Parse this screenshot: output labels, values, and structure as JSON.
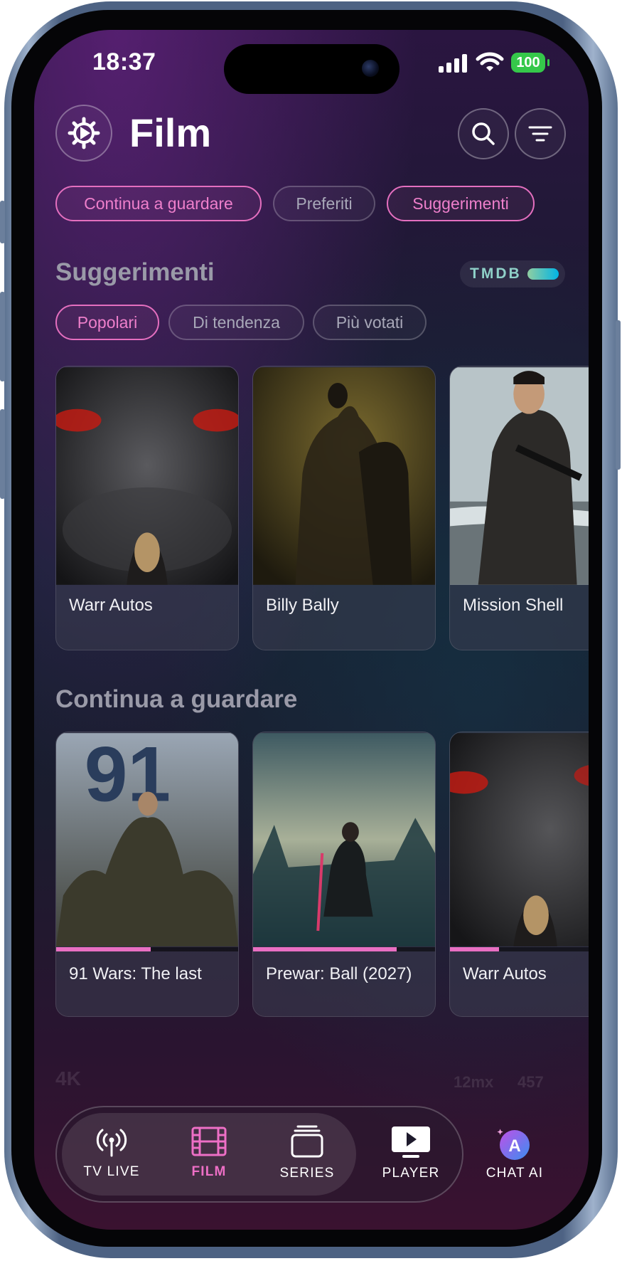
{
  "status_bar": {
    "time": "18:37",
    "battery": "100"
  },
  "header": {
    "title": "Film"
  },
  "top_filters": [
    {
      "label": "Continua a guardare",
      "active": true
    },
    {
      "label": "Preferiti",
      "active": false
    },
    {
      "label": "Suggerimenti",
      "active": true
    }
  ],
  "suggestions": {
    "title": "Suggerimenti",
    "badge": "TMDB",
    "tabs": [
      {
        "label": "Popolari",
        "active": true
      },
      {
        "label": "Di tendenza",
        "active": false
      },
      {
        "label": "Più votati",
        "active": false
      }
    ],
    "items": [
      {
        "title": "Warr Autos"
      },
      {
        "title": "Billy Bally"
      },
      {
        "title": "Mission Shell"
      }
    ]
  },
  "continue_watching": {
    "title": "Continua a guardare",
    "items": [
      {
        "title": "91 Wars: The last",
        "progress": 0.52,
        "poster_text": "91"
      },
      {
        "title": "Prewar: Ball (2027)",
        "progress": 0.79
      },
      {
        "title": "Warr Autos",
        "progress": 0.27
      }
    ]
  },
  "next_section": {
    "title": "4K",
    "chips": [
      "12mx",
      "457"
    ]
  },
  "bottom_nav": {
    "items": [
      {
        "label": "TV LIVE",
        "icon": "antenna-icon",
        "active": false
      },
      {
        "label": "FILM",
        "icon": "film-icon",
        "active": true
      },
      {
        "label": "SERIES",
        "icon": "stack-icon",
        "active": false
      },
      {
        "label": "PLAYER",
        "icon": "play-icon",
        "active": false
      }
    ],
    "chat": {
      "label": "CHAT AI",
      "icon": "ai-icon"
    }
  },
  "colors": {
    "accent": "#e86fc2",
    "tmdb": "#01b4e4",
    "battery": "#35c84a"
  }
}
